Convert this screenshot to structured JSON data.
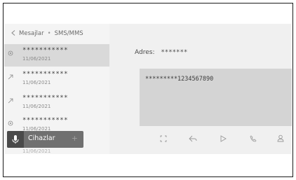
{
  "breadcrumb": {
    "back_icon": "chevron-left-icon",
    "parent": "Mesajlar",
    "current": "SMS/MMS"
  },
  "messages": [
    {
      "sender": "***********",
      "date": "11/06/2021",
      "icon": "unread-message-icon",
      "selected": true
    },
    {
      "sender": "***********",
      "date": "11/06/2021",
      "icon": "sent-arrow-icon",
      "selected": false
    },
    {
      "sender": "***********",
      "date": "11/06/2021",
      "icon": "sent-arrow-icon",
      "selected": false
    },
    {
      "sender": "***********",
      "date": "11/06/2021",
      "icon": "unread-message-icon",
      "selected": false
    }
  ],
  "detail": {
    "address_label": "Adres:",
    "address_value": "*******",
    "body": "*********1234567890"
  },
  "actions": [
    "expand-icon",
    "reply-icon",
    "play-icon",
    "call-icon",
    "contact-icon"
  ],
  "voice": {
    "mic_icon": "microphone-icon",
    "device_label": "Cihazlar",
    "plus_icon": "plus-icon"
  },
  "peek_date": "11/06/2021",
  "colors": {
    "selected_row": "#d9d9d9",
    "body_box": "#d4d4d4",
    "voice_bar": "#707070"
  }
}
